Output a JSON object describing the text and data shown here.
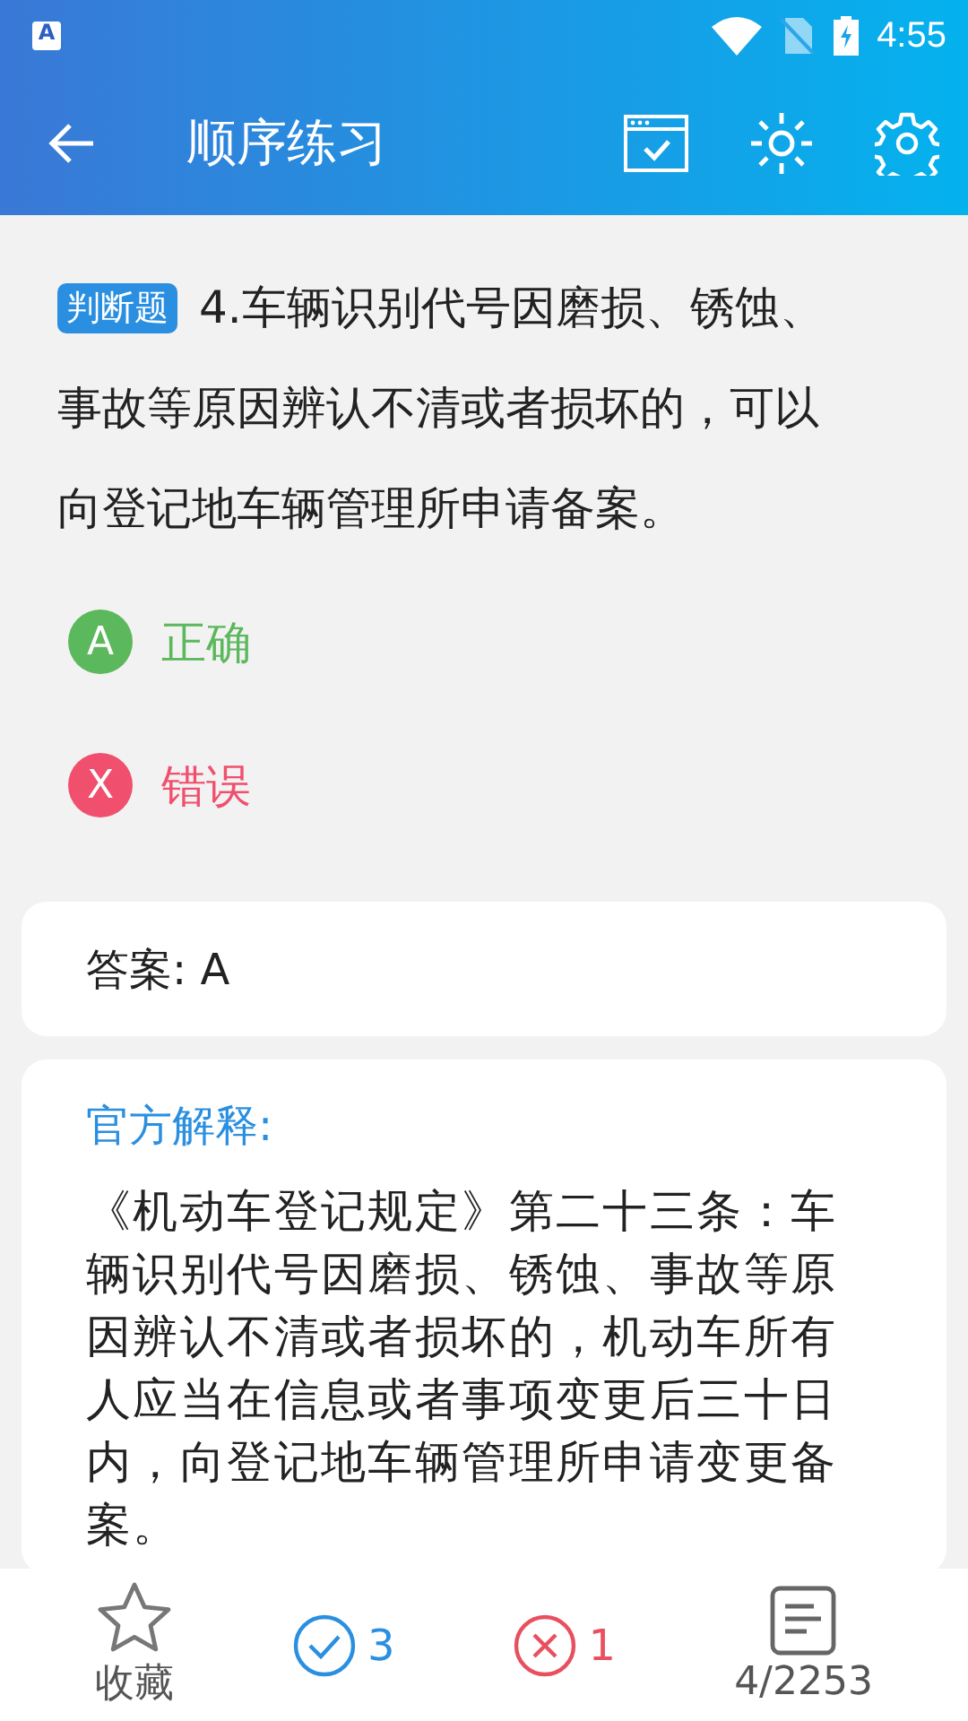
{
  "status_bar": {
    "notification_icon": "A",
    "time": "4:55"
  },
  "toolbar": {
    "title": "顺序练习"
  },
  "question": {
    "type_badge": "判断题",
    "lines": [
      "4.车辆识别代号因磨损、锈蚀、",
      "事故等原因辨认不清或者损坏的，可以",
      "向登记地车辆管理所申请备案。"
    ]
  },
  "options": [
    {
      "kind": "correct",
      "badge": "A",
      "text": "正确"
    },
    {
      "kind": "wrong",
      "badge": "X",
      "text": "错误"
    }
  ],
  "answer": {
    "text": "答案: A"
  },
  "explanation": {
    "title": "官方解释:",
    "text": "《机动车登记规定》第二十三条：车辆识别代号因磨损、锈蚀、事故等原因辨认不清或者损坏的，机动车所有人应当在信息或者事项变更后三十日内，向登记地车辆管理所申请变更备案。"
  },
  "bottom_bar": {
    "favorite_label": "收藏",
    "correct_count": "3",
    "wrong_count": "1",
    "progress": "4/2253"
  }
}
